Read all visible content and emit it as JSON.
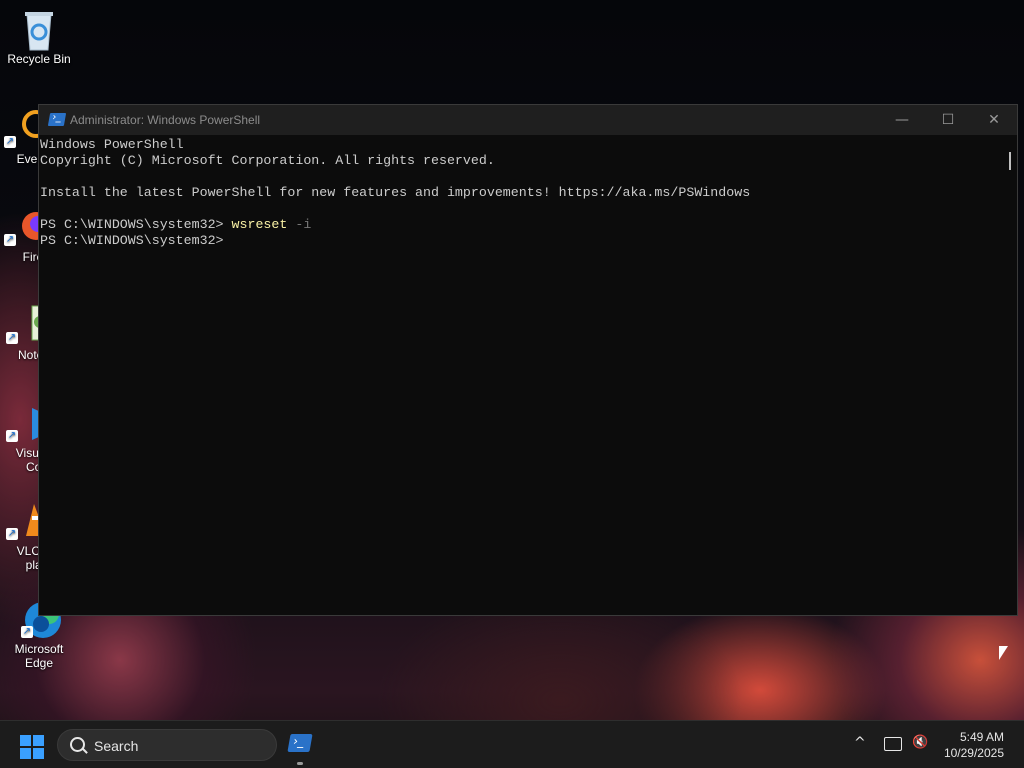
{
  "desktop": {
    "icons": [
      {
        "label": "Recycle Bin",
        "icon": "recycle-bin-icon"
      },
      {
        "label": "Every",
        "icon": "everything-icon"
      },
      {
        "label": "Fire",
        "icon": "firefox-icon"
      },
      {
        "label": "Notep",
        "icon": "notepad-icon"
      },
      {
        "label": "Visual\n Co",
        "icon": "vscode-icon"
      },
      {
        "label": "VLC r\n pla",
        "icon": "vlc-icon"
      },
      {
        "label": "Microsoft\nEdge",
        "icon": "edge-icon"
      }
    ]
  },
  "window": {
    "title": "Administrator: Windows PowerShell",
    "minimize": "—",
    "maximize": "☐",
    "close": "✕",
    "console": {
      "line1": "Windows PowerShell",
      "line2": "Copyright (C) Microsoft Corporation. All rights reserved.",
      "line3": "Install the latest PowerShell for new features and improvements! https://aka.ms/PSWindows",
      "prompt1": "PS C:\\WINDOWS\\system32> ",
      "cmd": "wsreset",
      "arg": " -i",
      "prompt2": "PS C:\\WINDOWS\\system32>"
    }
  },
  "taskbar": {
    "search_label": "Search",
    "time": "5:49 AM",
    "date": "10/29/2025",
    "chevron": "^",
    "accent": "#3aa0ff"
  }
}
